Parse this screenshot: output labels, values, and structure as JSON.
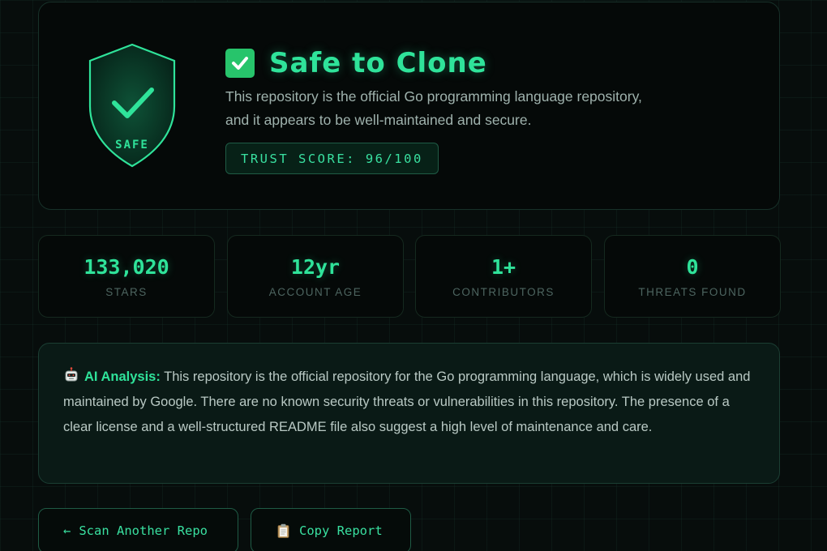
{
  "result": {
    "verdict": "Safe to Clone",
    "shield_label": "SAFE",
    "summary": "This repository is the official Go programming language repository, and it appears to be well-maintained and secure.",
    "trust_score_text": "TRUST SCORE: 96/100",
    "trust_score": 96,
    "trust_score_max": 100
  },
  "stats": [
    {
      "value": "133,020",
      "label": "STARS"
    },
    {
      "value": "12yr",
      "label": "ACCOUNT AGE"
    },
    {
      "value": "1+",
      "label": "CONTRIBUTORS"
    },
    {
      "value": "0",
      "label": "THREATS FOUND"
    }
  ],
  "ai_analysis": {
    "heading": "AI Analysis:",
    "text": "This repository is the official repository for the Go programming language, which is widely used and maintained by Google. There are no known security threats or vulnerabilities in this repository. The presence of a clear license and a well-structured README file also suggest a high level of maintenance and care."
  },
  "actions": {
    "scan_another_label": "Scan Another Repo",
    "scan_another_arrow": "←",
    "copy_report_label": "Copy Report"
  },
  "icons": {
    "shield": "shield-check-icon",
    "verdict": "check-box-icon",
    "ai": "robot-icon",
    "copy": "clipboard-icon"
  },
  "colors": {
    "accent": "#2fe39a",
    "check_box": "#27c46b",
    "background": "#070d0c"
  }
}
